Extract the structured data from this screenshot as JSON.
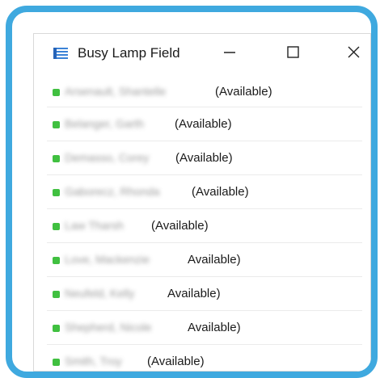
{
  "window": {
    "title": "Busy Lamp Field",
    "app_icon": "list-icon",
    "controls": [
      "minimize-icon",
      "maximize-icon",
      "close-icon"
    ]
  },
  "colors": {
    "frame_border": "#3fa9df",
    "lamp_available": "#40c040",
    "app_icon": "#3b82d6"
  },
  "contacts": [
    {
      "name": "Arsenault, Shantelle",
      "status": "(Available)"
    },
    {
      "name": "Belanger, Garth",
      "status": "(Available)"
    },
    {
      "name": "Demasso, Corey",
      "status": "(Available)"
    },
    {
      "name": "Gaborecz, Rhonda",
      "status": "(Available)"
    },
    {
      "name": "Law Tharsh",
      "status": "(Available)"
    },
    {
      "name": "Love, Mackenzie",
      "status": "Available)"
    },
    {
      "name": "Neufeld, Kelly",
      "status": "Available)"
    },
    {
      "name": "Shepherd, Nicole",
      "status": "Available)"
    },
    {
      "name": "Smith, Troy",
      "status": "(Available)"
    }
  ]
}
